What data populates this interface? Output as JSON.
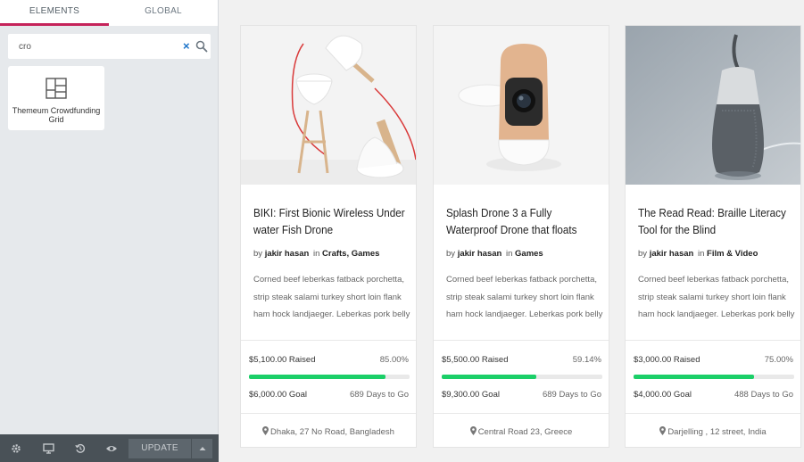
{
  "sidebar": {
    "tabs": [
      {
        "label": "ELEMENTS",
        "active": true
      },
      {
        "label": "GLOBAL",
        "active": false
      }
    ],
    "search": {
      "value": "cro",
      "clear_glyph": "×"
    },
    "widget": {
      "label": "Themeum Crowdfunding Grid",
      "icon": "grid-layout-icon"
    },
    "bottombar": {
      "icons": [
        "gear-icon",
        "desktop-icon",
        "history-icon",
        "eye-icon"
      ],
      "update_label": "UPDATE"
    }
  },
  "accent_colors": {
    "tab_active": "#c5235a",
    "progress": "#1bcf68",
    "clear": "#1a73c9"
  },
  "cards": [
    {
      "title": "BIKI: First Bionic Wireless Under water Fish Drone",
      "by": "by",
      "author": "jakir hasan",
      "in": "in",
      "categories": "Crafts, Games",
      "excerpt": "Corned beef leberkas fatback porchetta, strip steak salami turkey short loin flank ham hock landjaeger. Leberkas pork belly",
      "raised": "$5,100.00 Raised",
      "percent_text": "85.00%",
      "percent": 85,
      "goal": "$6,000.00 Goal",
      "days": "689 Days to Go",
      "location": "Dhaka, 27 No Road, Bangladesh"
    },
    {
      "title": "Splash Drone 3 a Fully Waterproof Drone that floats",
      "by": "by",
      "author": "jakir hasan",
      "in": "in",
      "categories": "Games",
      "excerpt": "Corned beef leberkas fatback porchetta, strip steak salami turkey short loin flank ham hock landjaeger. Leberkas pork belly",
      "raised": "$5,500.00 Raised",
      "percent_text": "59.14%",
      "percent": 59.14,
      "goal": "$9,300.00 Goal",
      "days": "689 Days to Go",
      "location": "Central Road 23, Greece"
    },
    {
      "title": "The Read Read: Braille Literacy Tool for the Blind",
      "by": "by",
      "author": "jakir hasan",
      "in": "in",
      "categories": "Film & Video",
      "excerpt": "Corned beef leberkas fatback porchetta, strip steak salami turkey short loin flank ham hock landjaeger. Leberkas pork belly",
      "raised": "$3,000.00 Raised",
      "percent_text": "75.00%",
      "percent": 75,
      "goal": "$4,000.00 Goal",
      "days": "488 Days to Go",
      "location": "Darjelling , 12 street, India"
    }
  ]
}
